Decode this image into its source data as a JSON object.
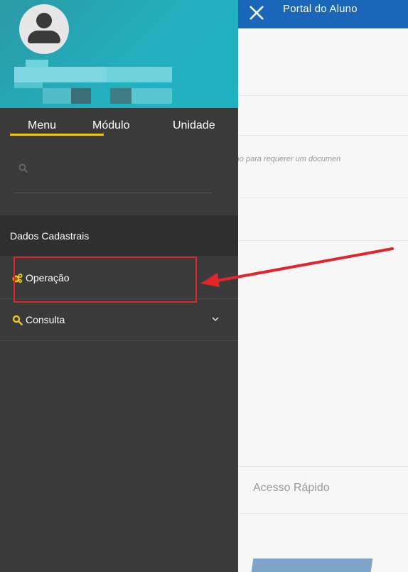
{
  "topbar": {
    "title": "Portal do Aluno"
  },
  "background": {
    "notice_text": "o Aluno para requerer um documen",
    "faded_text": "... ... ... ... ... ...",
    "quick_access": "Acesso Rápido"
  },
  "sidebar": {
    "tabs": [
      {
        "label": "Menu",
        "active": true
      },
      {
        "label": "Módulo",
        "active": false
      },
      {
        "label": "Unidade",
        "active": false
      }
    ],
    "search": {
      "placeholder": "",
      "value": ""
    },
    "section_header": "Dados Cadastrais",
    "items": [
      {
        "label": "Operação",
        "icon": "gears-icon",
        "has_chevron": false,
        "highlighted": true
      },
      {
        "label": "Consulta",
        "icon": "search-icon",
        "has_chevron": true,
        "highlighted": false
      }
    ]
  },
  "colors": {
    "topbar": "#1a66b8",
    "sidebar": "#3a3a3a",
    "profile_teal": "#23b0bf",
    "accent_yellow": "#f2c318",
    "annotation_red": "#e0262b"
  }
}
